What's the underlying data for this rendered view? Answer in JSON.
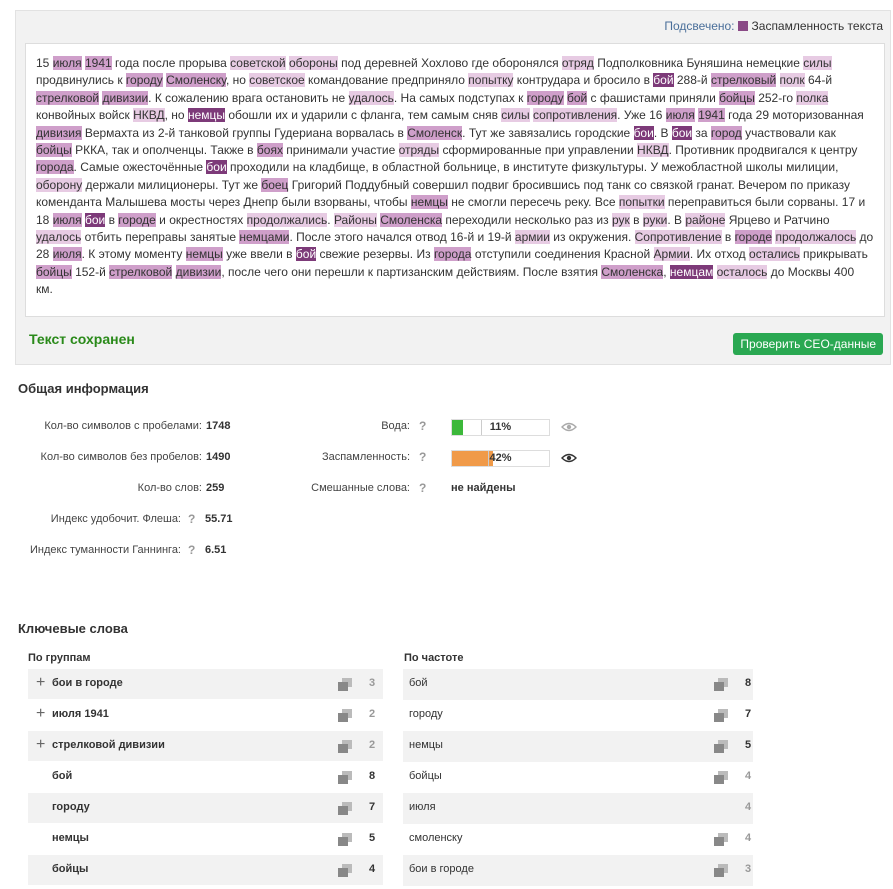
{
  "legend": {
    "label": "Подсвечено:",
    "item": "Заспамленность текста"
  },
  "text_segments": [
    [
      "15 ",
      0
    ],
    [
      "июля",
      2
    ],
    [
      " ",
      0
    ],
    [
      "1941",
      2
    ],
    [
      " года после прорыва ",
      0
    ],
    [
      "советской",
      1
    ],
    [
      " ",
      0
    ],
    [
      "обороны",
      1
    ],
    [
      " под деревней Хохлово где оборонялся ",
      0
    ],
    [
      "отряд",
      1
    ],
    [
      " Подполковника Буняшина немецкие ",
      0
    ],
    [
      "силы",
      1
    ],
    [
      " продвинулись к ",
      0
    ],
    [
      "городу",
      2
    ],
    [
      " ",
      0
    ],
    [
      "Смоленску",
      2
    ],
    [
      ", но ",
      0
    ],
    [
      "советское",
      1
    ],
    [
      " командование предприняло ",
      0
    ],
    [
      "попытку",
      1
    ],
    [
      " контрудара и бросило в ",
      0
    ],
    [
      "бой",
      3
    ],
    [
      " 288-й ",
      0
    ],
    [
      "стрелковый",
      2
    ],
    [
      " ",
      0
    ],
    [
      "полк",
      1
    ],
    [
      " 64-й ",
      0
    ],
    [
      "стрелковой",
      2
    ],
    [
      " ",
      0
    ],
    [
      "дивизии",
      2
    ],
    [
      ". К сожалению врага остановить не ",
      0
    ],
    [
      "удалось",
      1
    ],
    [
      ". На самых подступах к ",
      0
    ],
    [
      "городу",
      2
    ],
    [
      " ",
      0
    ],
    [
      "бой",
      2
    ],
    [
      " с фашистами приняли ",
      0
    ],
    [
      "бойцы",
      2
    ],
    [
      " 252-го ",
      0
    ],
    [
      "полка",
      1
    ],
    [
      " конвойных войск ",
      0
    ],
    [
      "НКВД",
      1
    ],
    [
      ", но ",
      0
    ],
    [
      "немцы",
      3
    ],
    [
      " обошли их и ударили с фланга, тем самым сняв ",
      0
    ],
    [
      "силы",
      1
    ],
    [
      " ",
      0
    ],
    [
      "сопротивления",
      1
    ],
    [
      ". Уже 16 ",
      0
    ],
    [
      "июля",
      2
    ],
    [
      " ",
      0
    ],
    [
      "1941",
      2
    ],
    [
      " года 29 моторизованная ",
      0
    ],
    [
      "дивизия",
      2
    ],
    [
      " Вермахта из 2-й танковой группы Гудериана ворвалась в ",
      0
    ],
    [
      "Смоленск",
      2
    ],
    [
      ". Тут же завязались городские ",
      0
    ],
    [
      "бои",
      3
    ],
    [
      ". В ",
      0
    ],
    [
      "бои",
      3
    ],
    [
      " за ",
      0
    ],
    [
      "город",
      2
    ],
    [
      " участвовали как ",
      0
    ],
    [
      "бойцы",
      2
    ],
    [
      " РККА, так и ополченцы. Также в ",
      0
    ],
    [
      "боях",
      2
    ],
    [
      " принимали участие ",
      0
    ],
    [
      "отряды",
      1
    ],
    [
      " сформированные при управлении ",
      0
    ],
    [
      "НКВД",
      1
    ],
    [
      ". Противник продвигался к центру ",
      0
    ],
    [
      "города",
      2
    ],
    [
      ". Самые ожесточённые ",
      0
    ],
    [
      "бои",
      3
    ],
    [
      " проходили на кладбище, в областной больнице, в институте физкультуры. У межобластной школы милиции, ",
      0
    ],
    [
      "оборону",
      1
    ],
    [
      " держали милиционеры. Тут же ",
      0
    ],
    [
      "боец",
      2
    ],
    [
      " Григорий Поддубный совершил подвиг бросившись под танк со связкой гранат. Вечером по приказу коменданта Малышева мосты через Днепр были взорваны, чтобы ",
      0
    ],
    [
      "немцы",
      2
    ],
    [
      " не смогли пересечь реку. Все ",
      0
    ],
    [
      "попытки",
      1
    ],
    [
      " переправиться были сорваны. 17 и 18 ",
      0
    ],
    [
      "июля",
      2
    ],
    [
      " ",
      0
    ],
    [
      "бои",
      3
    ],
    [
      " в ",
      0
    ],
    [
      "городе",
      2
    ],
    [
      " и окрестностях ",
      0
    ],
    [
      "продолжались",
      1
    ],
    [
      ". ",
      0
    ],
    [
      "Районы",
      1
    ],
    [
      " ",
      0
    ],
    [
      "Смоленска",
      2
    ],
    [
      " переходили несколько раз из ",
      0
    ],
    [
      "рук",
      1
    ],
    [
      " в ",
      0
    ],
    [
      "руки",
      1
    ],
    [
      ". В ",
      0
    ],
    [
      "районе",
      1
    ],
    [
      " Ярцево и Ратчино ",
      0
    ],
    [
      "удалось",
      1
    ],
    [
      " отбить переправы занятые ",
      0
    ],
    [
      "немцами",
      2
    ],
    [
      ". После этого начался отвод 16-й и 19-й ",
      0
    ],
    [
      "армии",
      1
    ],
    [
      " из окружения. ",
      0
    ],
    [
      "Сопротивление",
      1
    ],
    [
      " в ",
      0
    ],
    [
      "городе",
      2
    ],
    [
      " ",
      0
    ],
    [
      "продолжалось",
      1
    ],
    [
      " до 28 ",
      0
    ],
    [
      "июля",
      2
    ],
    [
      ". К этому моменту ",
      0
    ],
    [
      "немцы",
      2
    ],
    [
      " уже ввели в ",
      0
    ],
    [
      "бой",
      3
    ],
    [
      " свежие резервы. Из ",
      0
    ],
    [
      "города",
      2
    ],
    [
      " отступили соединения Красной ",
      0
    ],
    [
      "Армии",
      1
    ],
    [
      ". Их отход ",
      0
    ],
    [
      "остались",
      1
    ],
    [
      " прикрывать ",
      0
    ],
    [
      "бойцы",
      2
    ],
    [
      " 152-й ",
      0
    ],
    [
      "стрелковой",
      2
    ],
    [
      " ",
      0
    ],
    [
      "дивизии",
      2
    ],
    [
      ", после чего они перешли к партизанским действиям. После взятия ",
      0
    ],
    [
      "Смоленска",
      2
    ],
    [
      ", ",
      0
    ],
    [
      "немцам",
      3
    ],
    [
      " ",
      0
    ],
    [
      "осталось",
      1
    ],
    [
      " до Москвы 400 км.",
      0
    ]
  ],
  "status": {
    "saved": "Текст сохранен",
    "check_button": "Проверить СЕО-данные"
  },
  "general": {
    "title": "Общая информация",
    "chars_with_spaces_label": "Кол-во символов с пробелами:",
    "chars_with_spaces": "1748",
    "chars_no_spaces_label": "Кол-во символов без пробелов:",
    "chars_no_spaces": "1490",
    "words_label": "Кол-во слов:",
    "words": "259",
    "flesch_label": "Индекс удобочит. Флеша:",
    "flesch": "55.71",
    "gunning_label": "Индекс туманности Ганнинга:",
    "gunning": "6.51",
    "water_label": "Вода:",
    "water_text": "11%",
    "water_value": 0.11,
    "water_color": "#3cb83a",
    "spam_label": "Заспамленность:",
    "spam_text": "42%",
    "spam_value": 0.42,
    "spam_color": "#f09a49",
    "mixed_label": "Смешанные слова:",
    "mixed_value": "не найдены",
    "help": "?"
  },
  "keywords": {
    "title": "Ключевые слова",
    "groups_head": "По группам",
    "freq_head": "По частоте",
    "groups": [
      {
        "word": "бои в городе",
        "count": "3",
        "expand": true
      },
      {
        "word": "июля 1941",
        "count": "2",
        "expand": true
      },
      {
        "word": "стрелковой дивизии",
        "count": "2",
        "expand": true
      },
      {
        "word": "бой",
        "count": "8",
        "expand": false
      },
      {
        "word": "городу",
        "count": "7",
        "expand": false
      },
      {
        "word": "немцы",
        "count": "5",
        "expand": false
      },
      {
        "word": "бойцы",
        "count": "4",
        "expand": false
      }
    ],
    "freq": [
      {
        "word": "бой",
        "count": "8"
      },
      {
        "word": "городу",
        "count": "7"
      },
      {
        "word": "немцы",
        "count": "5"
      },
      {
        "word": "бойцы",
        "count": "4"
      },
      {
        "word": "июля",
        "count": "4"
      },
      {
        "word": "смоленску",
        "count": "4"
      },
      {
        "word": "бои в городе",
        "count": "3"
      }
    ]
  }
}
